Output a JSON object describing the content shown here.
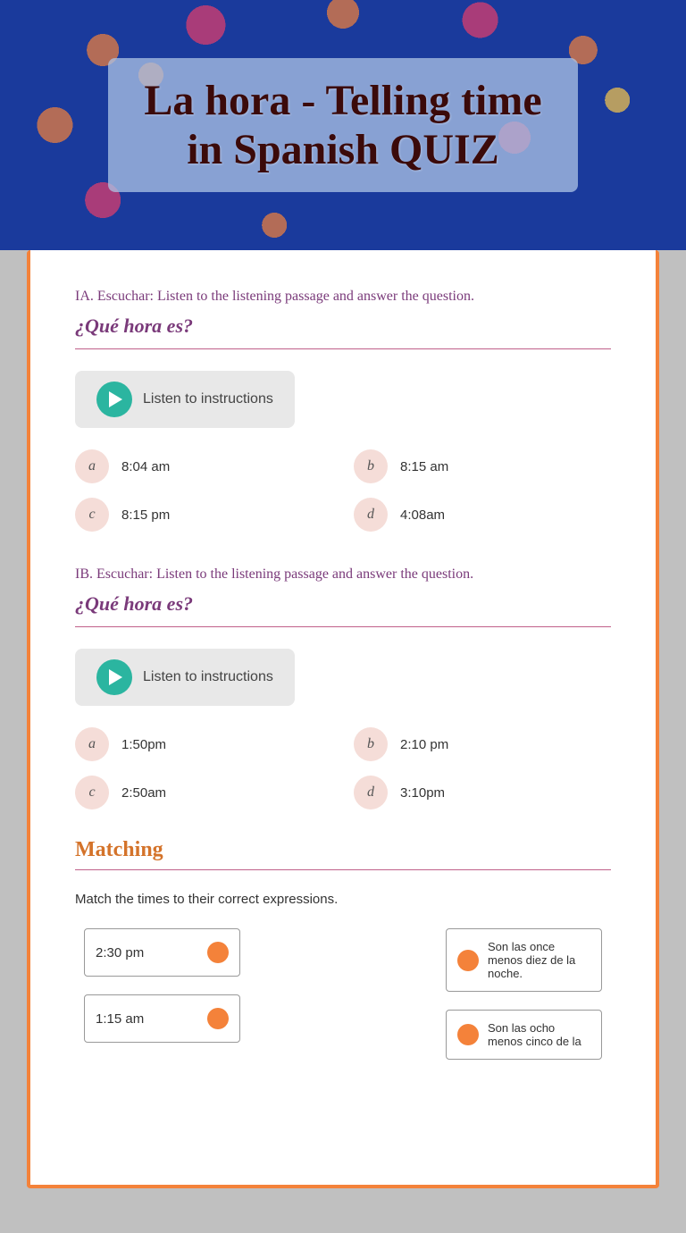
{
  "header": {
    "title_line1": "La hora - Telling time",
    "title_line2": "in Spanish QUIZ"
  },
  "sectionIA": {
    "instruction": "IA.  Escuchar:  Listen to the listening passage and answer the question.",
    "question": "¿Qué hora es?",
    "listen_button": "Listen to instructions",
    "options": [
      {
        "letter": "a",
        "value": "8:04 am"
      },
      {
        "letter": "b",
        "value": "8:15 am"
      },
      {
        "letter": "c",
        "value": "8:15 pm"
      },
      {
        "letter": "d",
        "value": "4:08am"
      }
    ]
  },
  "sectionIB": {
    "instruction": "IB.  Escuchar:  Listen to the listening passage and answer the question.",
    "question": "¿Qué hora es?",
    "listen_button": "Listen to instructions",
    "options": [
      {
        "letter": "a",
        "value": "1:50pm"
      },
      {
        "letter": "b",
        "value": "2:10 pm"
      },
      {
        "letter": "c",
        "value": "2:50am"
      },
      {
        "letter": "d",
        "value": "3:10pm"
      }
    ]
  },
  "matching": {
    "title": "Matching",
    "instruction": "Match the times to their correct expressions.",
    "left_items": [
      {
        "value": "2:30 pm"
      },
      {
        "value": "1:15 am"
      }
    ],
    "right_items": [
      {
        "value": "Son las once menos diez de la noche."
      },
      {
        "value": "Son las ocho menos cinco de la"
      }
    ]
  }
}
